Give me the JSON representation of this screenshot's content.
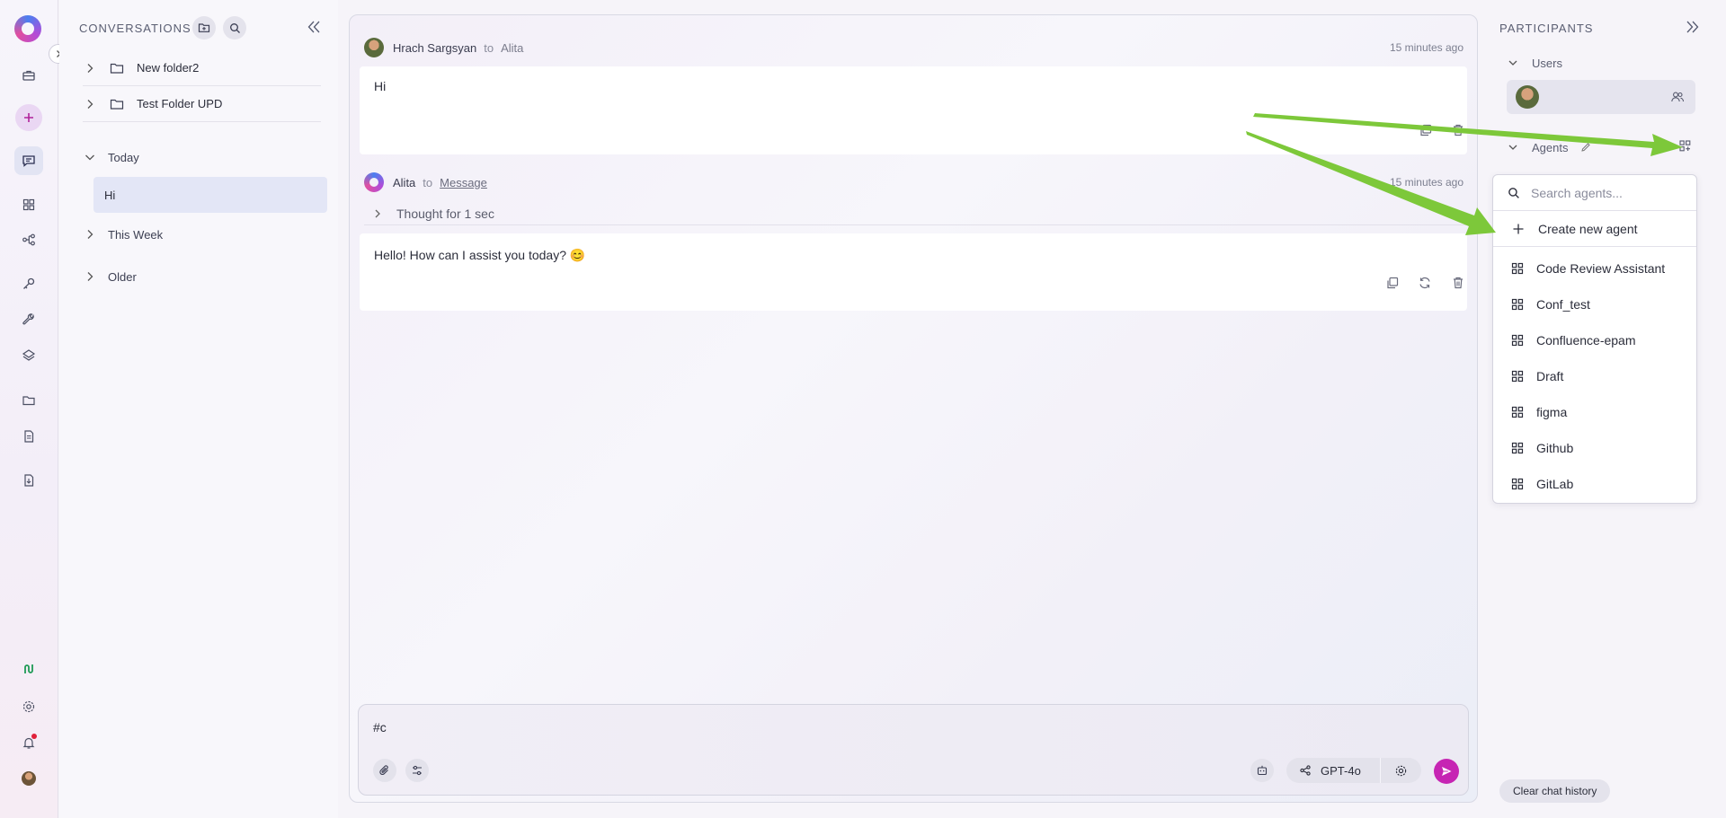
{
  "sidebar": {
    "items": [
      {
        "icon": "briefcase-icon",
        "active": false
      },
      {
        "icon": "plus-icon",
        "active": false
      },
      {
        "icon": "chat-icon",
        "active": true
      },
      {
        "icon": "grid-icon",
        "active": false
      },
      {
        "icon": "flow-icon",
        "active": false
      },
      {
        "icon": "key-icon",
        "active": false
      },
      {
        "icon": "wrench-icon",
        "active": false
      },
      {
        "icon": "layers-icon",
        "active": false
      },
      {
        "icon": "folder-icon",
        "active": false
      },
      {
        "icon": "document-icon",
        "active": false
      },
      {
        "icon": "file-import-icon",
        "active": false
      }
    ],
    "bottom": [
      "integrations-icon",
      "settings-icon",
      "bell-icon",
      "avatar"
    ]
  },
  "conversations": {
    "title": "CONVERSATIONS",
    "folders": [
      {
        "label": "New folder2"
      },
      {
        "label": "Test Folder UPD"
      }
    ],
    "groups": {
      "today": "Today",
      "this_week": "This Week",
      "older": "Older"
    },
    "today_items": [
      {
        "label": "Hi",
        "selected": true
      }
    ]
  },
  "chat": {
    "messages": [
      {
        "author": "Hrach Sargsyan",
        "to_word": "to",
        "target": "Alita",
        "time": "15 minutes ago",
        "text": "Hi"
      },
      {
        "author": "Alita",
        "to_word": "to",
        "target": "Message",
        "time": "15 minutes ago",
        "thought": "Thought for 1 sec",
        "text": "Hello! How can I assist you today? 😊"
      }
    ],
    "composer": {
      "value": "#c",
      "model": "GPT-4o"
    }
  },
  "participants": {
    "title": "PARTICIPANTS",
    "users_label": "Users",
    "agents_label": "Agents",
    "dropdown": {
      "search_placeholder": "Search agents...",
      "create_label": "Create new agent",
      "agents": [
        "Code Review Assistant",
        "Conf_test",
        "Confluence-epam",
        "Draft",
        "figma",
        "Github",
        "GitLab"
      ]
    },
    "clear_label": "Clear chat history"
  },
  "colors": {
    "accent": "#c625b3",
    "annotation_arrow": "#7dc83a",
    "selected_bg": "#e3e6f6"
  }
}
